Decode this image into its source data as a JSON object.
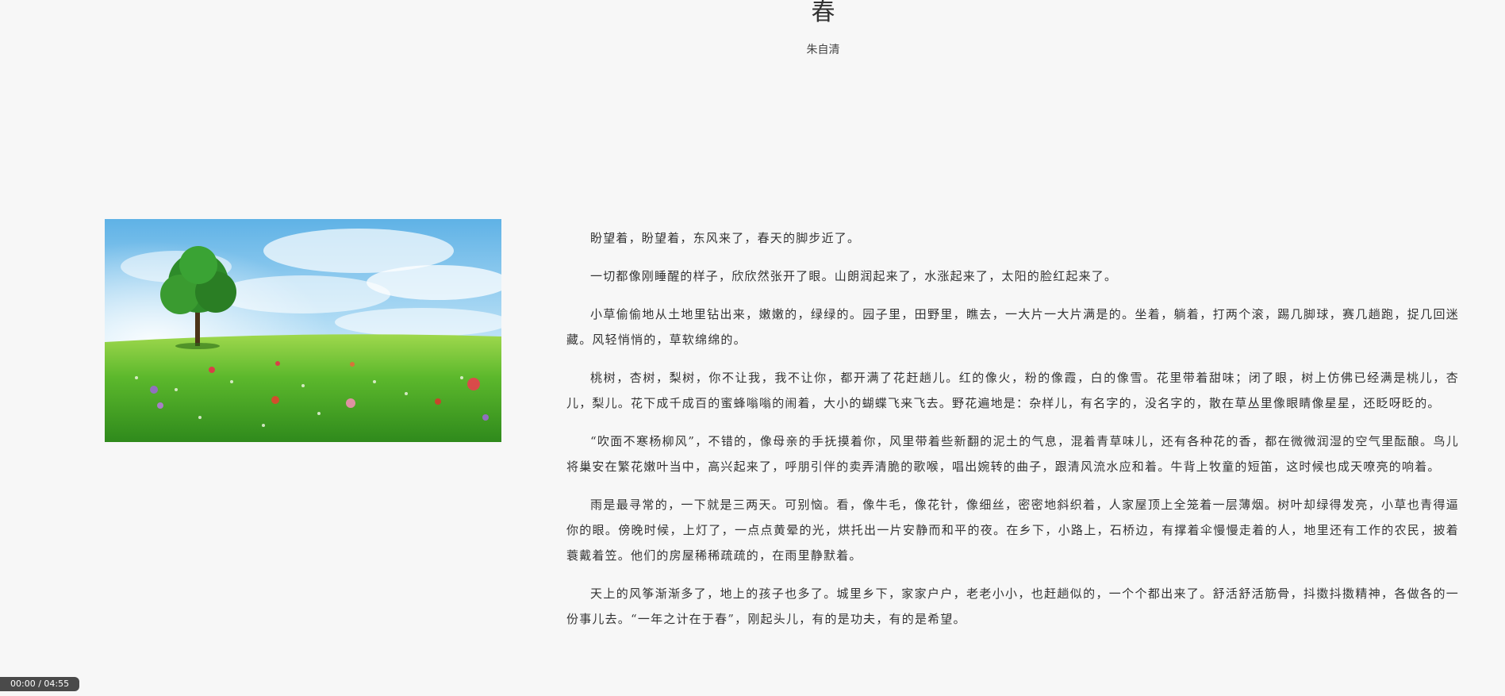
{
  "article": {
    "title": "春",
    "author": "朱自清",
    "paragraphs": [
      "盼望着，盼望着，东风来了，春天的脚步近了。",
      "一切都像刚睡醒的样子，欣欣然张开了眼。山朗润起来了，水涨起来了，太阳的脸红起来了。",
      "小草偷偷地从土地里钻出来，嫩嫩的，绿绿的。园子里，田野里，瞧去，一大片一大片满是的。坐着，躺着，打两个滚，踢几脚球，赛几趟跑，捉几回迷藏。风轻悄悄的，草软绵绵的。",
      "桃树，杏树，梨树，你不让我，我不让你，都开满了花赶趟儿。红的像火，粉的像霞，白的像雪。花里带着甜味；闭了眼，树上仿佛已经满是桃儿，杏儿，梨儿。花下成千成百的蜜蜂嗡嗡的闹着，大小的蝴蝶飞来飞去。野花遍地是：杂样儿，有名字的，没名字的，散在草丛里像眼睛像星星，还眨呀眨的。",
      "“吹面不寒杨柳风”，不错的，像母亲的手抚摸着你，风里带着些新翻的泥土的气息，混着青草味儿，还有各种花的香，都在微微润湿的空气里酝酿。鸟儿将巢安在繁花嫩叶当中，高兴起来了，呼朋引伴的卖弄清脆的歌喉，唱出婉转的曲子，跟清风流水应和着。牛背上牧童的短笛，这时候也成天嘹亮的响着。",
      "雨是最寻常的，一下就是三两天。可别恼。看，像牛毛，像花针，像细丝，密密地斜织着，人家屋顶上全笼着一层薄烟。树叶却绿得发亮，小草也青得逼你的眼。傍晚时候，上灯了，一点点黄晕的光，烘托出一片安静而和平的夜。在乡下，小路上，石桥边，有撑着伞慢慢走着的人，地里还有工作的农民，披着蓑戴着笠。他们的房屋稀稀疏疏的，在雨里静默着。",
      "天上的风筝渐渐多了，地上的孩子也多了。城里乡下，家家户户，老老小小，也赶趟似的，一个个都出来了。舒活舒活筋骨，抖擞抖擞精神，各做各的一份事儿去。“一年之计在于春”，刚起头儿，有的是功夫，有的是希望。"
    ]
  },
  "media": {
    "time_display": "00:00 / 04:55"
  }
}
